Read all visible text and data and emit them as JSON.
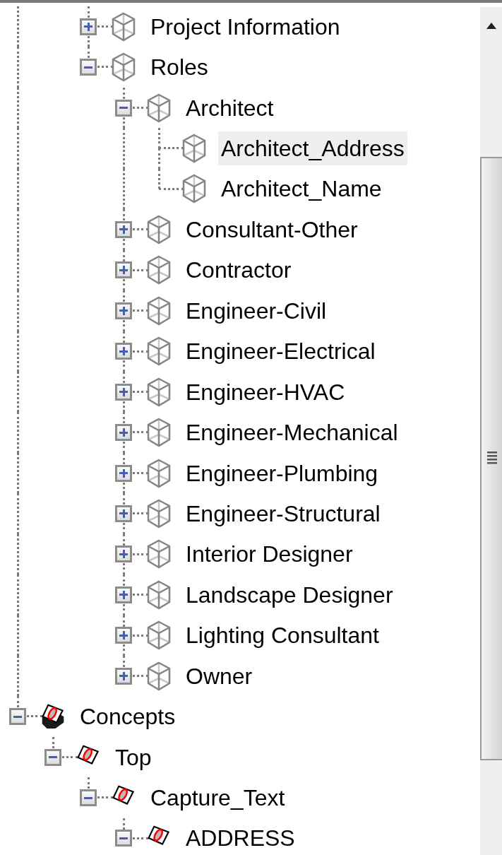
{
  "tree": [
    {
      "children": [
        {
          "children": [
            {
              "label": "Project Information",
              "kind": "cube",
              "expanded": false,
              "selected": false
            },
            {
              "label": "Roles",
              "kind": "cube",
              "expanded": true,
              "selected": false,
              "children": [
                {
                  "label": "Architect",
                  "kind": "cube",
                  "expanded": true,
                  "selected": false,
                  "children": [
                    {
                      "label": "Architect_Address",
                      "kind": "cube",
                      "selected": true
                    },
                    {
                      "label": "Architect_Name",
                      "kind": "cube",
                      "selected": false
                    }
                  ]
                },
                {
                  "label": "Consultant-Other",
                  "kind": "cube",
                  "expanded": false,
                  "selected": false
                },
                {
                  "label": "Contractor",
                  "kind": "cube",
                  "expanded": false,
                  "selected": false
                },
                {
                  "label": "Engineer-Civil",
                  "kind": "cube",
                  "expanded": false,
                  "selected": false
                },
                {
                  "label": "Engineer-Electrical",
                  "kind": "cube",
                  "expanded": false,
                  "selected": false
                },
                {
                  "label": "Engineer-HVAC",
                  "kind": "cube",
                  "expanded": false,
                  "selected": false
                },
                {
                  "label": "Engineer-Mechanical",
                  "kind": "cube",
                  "expanded": false,
                  "selected": false
                },
                {
                  "label": "Engineer-Plumbing",
                  "kind": "cube",
                  "expanded": false,
                  "selected": false
                },
                {
                  "label": "Engineer-Structural",
                  "kind": "cube",
                  "expanded": false,
                  "selected": false
                },
                {
                  "label": "Interior Designer",
                  "kind": "cube",
                  "expanded": false,
                  "selected": false
                },
                {
                  "label": "Landscape Designer",
                  "kind": "cube",
                  "expanded": false,
                  "selected": false
                },
                {
                  "label": "Lighting Consultant",
                  "kind": "cube",
                  "expanded": false,
                  "selected": false
                },
                {
                  "label": "Owner",
                  "kind": "cube",
                  "expanded": false,
                  "selected": false
                }
              ]
            }
          ]
        }
      ]
    },
    {
      "label": "Concepts",
      "kind": "concept-stack",
      "expanded": true,
      "selected": false,
      "children": [
        {
          "label": "Top",
          "kind": "concept",
          "expanded": true,
          "selected": false,
          "children": [
            {
              "label": "Capture_Text",
              "kind": "concept",
              "expanded": true,
              "selected": false,
              "children": [
                {
                  "label": "ADDRESS",
                  "kind": "concept",
                  "expanded": true,
                  "selected": false
                }
              ]
            }
          ]
        }
      ]
    }
  ]
}
